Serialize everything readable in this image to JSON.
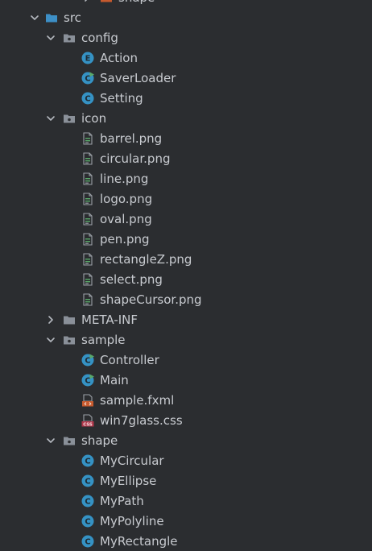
{
  "theme": {
    "background": "#2b2d30",
    "text": "#c8cbd0",
    "folder": "#8a9099",
    "source_folder": "#3d8fc6",
    "class_icon": "#3592c4",
    "enum_icon": "#3592c4",
    "runnable_badge": "#59a869",
    "fxml_icon": "#c75a2e",
    "css_icon": "#b0364a",
    "image_file_icon": "#9aa0a6",
    "cut_off_icon": "#c75a2e"
  },
  "tree": [
    {
      "label": "shape",
      "depth": 3,
      "kind": "folder-colored",
      "expanded": false,
      "icon": "folder-icon",
      "partial": true
    },
    {
      "label": "src",
      "depth": 0,
      "kind": "source-folder",
      "expanded": true,
      "icon": "source-folder-icon"
    },
    {
      "label": "config",
      "depth": 1,
      "kind": "package",
      "expanded": true,
      "icon": "package-icon"
    },
    {
      "label": "Action",
      "depth": 2,
      "kind": "enum",
      "icon": "enum-icon",
      "badge": "E"
    },
    {
      "label": "SaverLoader",
      "depth": 2,
      "kind": "class-runnable",
      "icon": "runnable-class-icon",
      "badge": "C"
    },
    {
      "label": "Setting",
      "depth": 2,
      "kind": "class",
      "icon": "class-icon",
      "badge": "C"
    },
    {
      "label": "icon",
      "depth": 1,
      "kind": "package",
      "expanded": true,
      "icon": "package-icon"
    },
    {
      "label": "barrel.png",
      "depth": 2,
      "kind": "image",
      "icon": "image-file-icon"
    },
    {
      "label": "circular.png",
      "depth": 2,
      "kind": "image",
      "icon": "image-file-icon"
    },
    {
      "label": "line.png",
      "depth": 2,
      "kind": "image",
      "icon": "image-file-icon"
    },
    {
      "label": "logo.png",
      "depth": 2,
      "kind": "image",
      "icon": "image-file-icon"
    },
    {
      "label": "oval.png",
      "depth": 2,
      "kind": "image",
      "icon": "image-file-icon"
    },
    {
      "label": "pen.png",
      "depth": 2,
      "kind": "image",
      "icon": "image-file-icon"
    },
    {
      "label": "rectangleZ.png",
      "depth": 2,
      "kind": "image",
      "icon": "image-file-icon"
    },
    {
      "label": "select.png",
      "depth": 2,
      "kind": "image",
      "icon": "image-file-icon"
    },
    {
      "label": "shapeCursor.png",
      "depth": 2,
      "kind": "image",
      "icon": "image-file-icon"
    },
    {
      "label": "META-INF",
      "depth": 1,
      "kind": "folder",
      "expanded": false,
      "icon": "folder-icon"
    },
    {
      "label": "sample",
      "depth": 1,
      "kind": "package",
      "expanded": true,
      "icon": "package-icon"
    },
    {
      "label": "Controller",
      "depth": 2,
      "kind": "class-runnable",
      "icon": "runnable-class-icon",
      "badge": "C"
    },
    {
      "label": "Main",
      "depth": 2,
      "kind": "class-runnable",
      "icon": "runnable-class-icon",
      "badge": "C"
    },
    {
      "label": "sample.fxml",
      "depth": 2,
      "kind": "fxml",
      "icon": "fxml-file-icon",
      "badge": "<>"
    },
    {
      "label": "win7glass.css",
      "depth": 2,
      "kind": "css",
      "icon": "css-file-icon",
      "badge": "CSS"
    },
    {
      "label": "shape",
      "depth": 1,
      "kind": "package",
      "expanded": true,
      "icon": "package-icon"
    },
    {
      "label": "MyCircular",
      "depth": 2,
      "kind": "class",
      "icon": "class-icon",
      "badge": "C"
    },
    {
      "label": "MyEllipse",
      "depth": 2,
      "kind": "class",
      "icon": "class-icon",
      "badge": "C"
    },
    {
      "label": "MyPath",
      "depth": 2,
      "kind": "class",
      "icon": "class-icon",
      "badge": "C"
    },
    {
      "label": "MyPolyline",
      "depth": 2,
      "kind": "class",
      "icon": "class-icon",
      "badge": "C"
    },
    {
      "label": "MyRectangle",
      "depth": 2,
      "kind": "class",
      "icon": "class-icon",
      "badge": "C"
    }
  ]
}
